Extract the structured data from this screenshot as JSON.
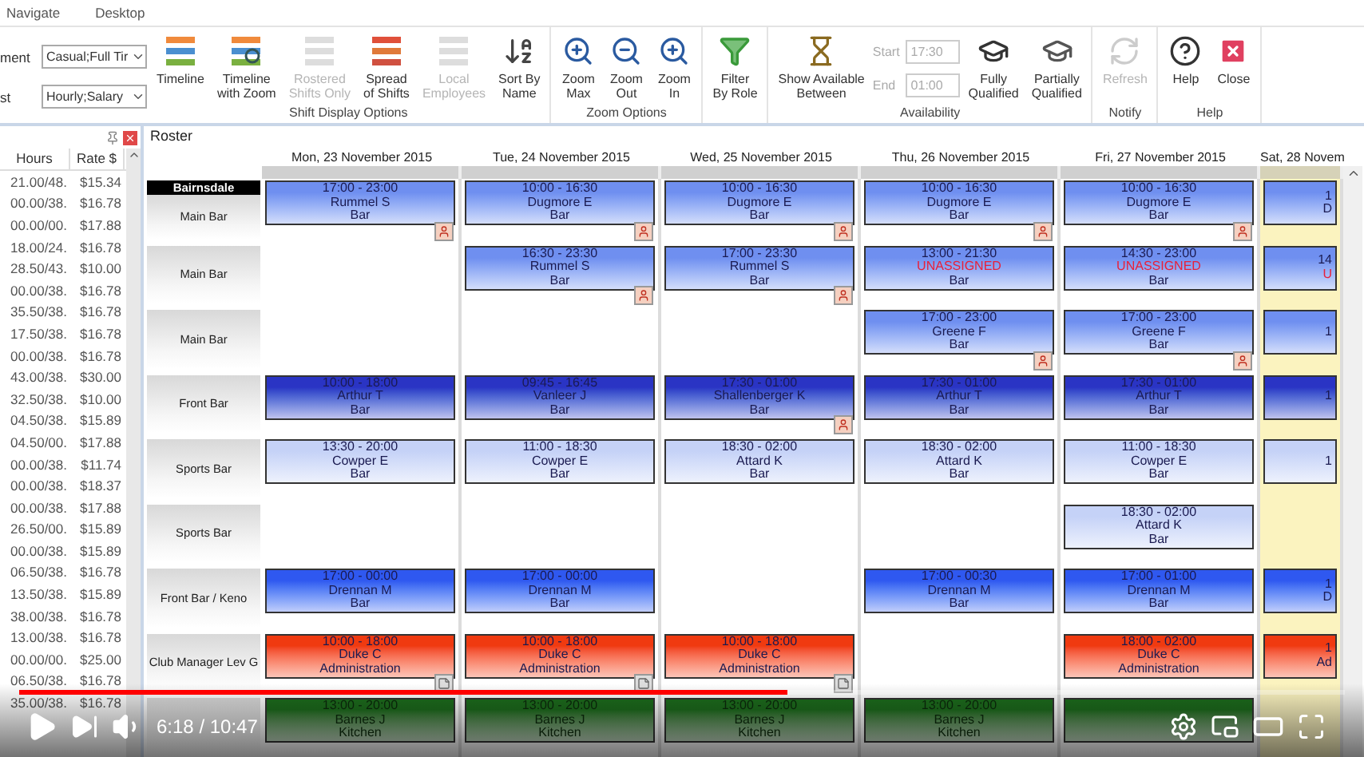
{
  "menu": [
    {
      "label": "Navigate"
    },
    {
      "label": "Desktop"
    }
  ],
  "filters": [
    {
      "label": "ment",
      "value": "Casual;Full Tir"
    },
    {
      "label": "st",
      "value": "Hourly;Salary"
    }
  ],
  "ribbon": [
    {
      "title": "Shift Display Options",
      "items": [
        {
          "kind": "timeline",
          "label": "Timeline",
          "disabled": false
        },
        {
          "kind": "zoomtimeline",
          "label": "Timeline\nwith Zoom",
          "disabled": false
        },
        {
          "kind": "rostered",
          "label": "Rostered\nShifts Only",
          "disabled": true
        },
        {
          "kind": "spread",
          "label": "Spread\nof Shifts",
          "disabled": false
        },
        {
          "kind": "local",
          "label": "Local\nEmployees",
          "disabled": true
        },
        {
          "kind": "sort",
          "label": "Sort By\nName",
          "disabled": false
        }
      ]
    },
    {
      "title": "Zoom Options",
      "items": [
        {
          "kind": "zoommax",
          "label": "Zoom\nMax",
          "disabled": false
        },
        {
          "kind": "zoomout",
          "label": "Zoom\nOut",
          "disabled": false
        },
        {
          "kind": "zoomin",
          "label": "Zoom\nIn",
          "disabled": false
        }
      ]
    },
    {
      "items": [
        {
          "kind": "filter",
          "label": "Filter\nBy Role",
          "disabled": false
        }
      ]
    },
    {
      "title": "Availability",
      "items": [
        {
          "kind": "available",
          "label": "Show Available\nBetween",
          "disabled": false
        },
        {
          "kind": "times",
          "fields": [
            {
              "label": "Start",
              "value": "17:30"
            },
            {
              "label": "End",
              "value": "01:00"
            }
          ]
        },
        {
          "kind": "fully",
          "label": "Fully\nQualified",
          "disabled": false
        },
        {
          "kind": "partially",
          "label": "Partially\nQualified",
          "disabled": false
        }
      ]
    },
    {
      "title": "Notify",
      "items": [
        {
          "kind": "refresh",
          "label": "Refresh",
          "disabled": true
        }
      ]
    },
    {
      "title": "Help",
      "items": [
        {
          "kind": "help",
          "label": "Help",
          "disabled": false
        },
        {
          "kind": "close",
          "label": "Close",
          "disabled": false
        }
      ]
    }
  ],
  "employees": {
    "columns": [
      "Hours",
      "Rate $"
    ],
    "rows": [
      [
        "21.00/48.",
        "$15.34"
      ],
      [
        "00.00/38.",
        "$16.78"
      ],
      [
        "00.00/00.",
        "$17.88"
      ],
      [
        "18.00/24.",
        "$16.78"
      ],
      [
        "28.50/43.",
        "$10.00"
      ],
      [
        "00.00/38.",
        "$16.78"
      ],
      [
        "35.50/38.",
        "$16.78"
      ],
      [
        "17.50/38.",
        "$16.78"
      ],
      [
        "00.00/38.",
        "$16.78"
      ],
      [
        "43.00/38.",
        "$30.00"
      ],
      [
        "32.50/38.",
        "$10.00"
      ],
      [
        "04.50/38.",
        "$15.89"
      ],
      [
        "04.50/00.",
        "$17.88"
      ],
      [
        "00.00/38.",
        "$11.74"
      ],
      [
        "00.00/38.",
        "$18.37"
      ],
      [
        "00.00/38.",
        "$17.88"
      ],
      [
        "26.50/00.",
        "$15.89"
      ],
      [
        "00.00/38.",
        "$15.89"
      ],
      [
        "06.50/38.",
        "$16.78"
      ],
      [
        "13.50/38.",
        "$15.89"
      ],
      [
        "38.00/38.",
        "$16.78"
      ],
      [
        "13.00/38.",
        "$16.78"
      ],
      [
        "00.00/00.",
        "$25.00"
      ],
      [
        "06.50/38.",
        "$16.78"
      ],
      [
        "35.00/38.",
        "$16.78"
      ]
    ]
  },
  "roster": {
    "title": "Roster",
    "location": "Bairnsdale",
    "days": [
      {
        "label": "Mon, 23 November 2015",
        "available": false
      },
      {
        "label": "Tue, 24 November 2015",
        "available": false
      },
      {
        "label": "Wed, 25 November 2015",
        "available": false
      },
      {
        "label": "Thu, 26 November 2015",
        "available": false
      },
      {
        "label": "Fri, 27 November 2015",
        "available": false
      },
      {
        "label": "Sat, 28 Novem",
        "available": true
      }
    ],
    "rows": [
      {
        "label": "Main Bar",
        "cells": [
          {
            "time": "17:00 - 23:00",
            "name": "Rummel S",
            "role": "Bar",
            "color": "#6f8ff0",
            "unassigned": false,
            "flag": true,
            "note": false
          },
          {
            "time": "10:00 - 16:30",
            "name": "Dugmore E",
            "role": "Bar",
            "color": "#6f8ff0",
            "unassigned": false,
            "flag": true,
            "note": false
          },
          {
            "time": "10:00 - 16:30",
            "name": "Dugmore E",
            "role": "Bar",
            "color": "#6f8ff0",
            "unassigned": false,
            "flag": true,
            "note": false
          },
          {
            "time": "10:00 - 16:30",
            "name": "Dugmore E",
            "role": "Bar",
            "color": "#6f8ff0",
            "unassigned": false,
            "flag": true,
            "note": false
          },
          {
            "time": "10:00 - 16:30",
            "name": "Dugmore E",
            "role": "Bar",
            "color": "#6f8ff0",
            "unassigned": false,
            "flag": true,
            "note": false
          },
          {
            "time": "1",
            "name": "D",
            "color": "#6f8ff0",
            "unassigned": false,
            "flag": false,
            "note": false
          }
        ]
      },
      {
        "label": "Main Bar",
        "cells": [
          null,
          {
            "time": "16:30 - 23:30",
            "name": "Rummel S",
            "role": "Bar",
            "color": "#6f8ff0",
            "unassigned": false,
            "flag": true,
            "note": false
          },
          {
            "time": "17:00 - 23:30",
            "name": "Rummel S",
            "role": "Bar",
            "color": "#6f8ff0",
            "unassigned": false,
            "flag": true,
            "note": false
          },
          {
            "time": "13:00 - 21:30",
            "name": "UNASSIGNED",
            "role": "Bar",
            "color": "#6f8ff0",
            "unassigned": true,
            "flag": false,
            "note": false
          },
          {
            "time": "14:30 - 23:00",
            "name": "UNASSIGNED",
            "role": "Bar",
            "color": "#6f8ff0",
            "unassigned": true,
            "flag": false,
            "note": false
          },
          {
            "time": "14",
            "name": "U",
            "color": "#6f8ff0",
            "unassigned": true,
            "flag": false,
            "note": false
          }
        ]
      },
      {
        "label": "Main Bar",
        "cells": [
          null,
          null,
          null,
          {
            "time": "17:00 - 23:00",
            "name": "Greene F",
            "role": "Bar",
            "color": "#6f8ff0",
            "unassigned": false,
            "flag": true,
            "note": false
          },
          {
            "time": "17:00 - 23:00",
            "name": "Greene F",
            "role": "Bar",
            "color": "#6f8ff0",
            "unassigned": false,
            "flag": true,
            "note": false
          },
          {
            "time": "1",
            "color": "#6f8ff0",
            "flag": false,
            "note": false
          }
        ]
      },
      {
        "label": "Front Bar",
        "cells": [
          {
            "time": "10:00 - 18:00",
            "name": "Arthur T",
            "role": "Bar",
            "color": "#2a34c4",
            "unassigned": false,
            "flag": false,
            "note": false
          },
          {
            "time": "09:45 - 16:45",
            "name": "Vanleer J",
            "role": "Bar",
            "color": "#2a34c4",
            "unassigned": false,
            "flag": false,
            "note": false
          },
          {
            "time": "17:30 - 01:00",
            "name": "Shallenberger K",
            "role": "Bar",
            "color": "#2a34c4",
            "unassigned": false,
            "flag": true,
            "note": false
          },
          {
            "time": "17:30 - 01:00",
            "name": "Arthur T",
            "role": "Bar",
            "color": "#2a34c4",
            "unassigned": false,
            "flag": false,
            "note": false
          },
          {
            "time": "17:30 - 01:00",
            "name": "Arthur T",
            "role": "Bar",
            "color": "#2a34c4",
            "unassigned": false,
            "flag": false,
            "note": false
          },
          {
            "time": "1",
            "color": "#2a34c4",
            "flag": false,
            "note": false
          }
        ]
      },
      {
        "label": "Sports Bar",
        "cells": [
          {
            "time": "13:30 - 20:00",
            "name": "Cowper E",
            "role": "Bar",
            "color": "#c5d2f7",
            "unassigned": false,
            "flag": false,
            "note": false
          },
          {
            "time": "11:00 - 18:30",
            "name": "Cowper E",
            "role": "Bar",
            "color": "#c5d2f7",
            "unassigned": false,
            "flag": false,
            "note": false
          },
          {
            "time": "18:30 - 02:00",
            "name": "Attard K",
            "role": "Bar",
            "color": "#c5d2f7",
            "unassigned": false,
            "flag": false,
            "note": false
          },
          {
            "time": "18:30 - 02:00",
            "name": "Attard K",
            "role": "Bar",
            "color": "#c5d2f7",
            "unassigned": false,
            "flag": false,
            "note": false
          },
          {
            "time": "11:00 - 18:30",
            "name": "Cowper E",
            "role": "Bar",
            "color": "#c5d2f7",
            "unassigned": false,
            "flag": false,
            "note": false
          },
          {
            "time": "1",
            "color": "#c5d2f7",
            "flag": false,
            "note": false
          }
        ]
      },
      {
        "label": "Sports Bar",
        "cells": [
          null,
          null,
          null,
          null,
          {
            "time": "18:30 - 02:00",
            "name": "Attard K",
            "role": "Bar",
            "color": "#c5d2f7",
            "unassigned": false,
            "flag": false,
            "note": false
          },
          null
        ]
      },
      {
        "label": "Front Bar / Keno",
        "cells": [
          {
            "time": "17:00 - 00:00",
            "name": "Drennan M",
            "role": "Bar",
            "color": "#2f58f0",
            "unassigned": false,
            "flag": false,
            "note": false
          },
          {
            "time": "17:00 - 00:00",
            "name": "Drennan M",
            "role": "Bar",
            "color": "#2f58f0",
            "unassigned": false,
            "flag": false,
            "note": false
          },
          null,
          {
            "time": "17:00 - 00:30",
            "name": "Drennan M",
            "role": "Bar",
            "color": "#2f58f0",
            "unassigned": false,
            "flag": false,
            "note": false
          },
          {
            "time": "17:00 - 01:00",
            "name": "Drennan M",
            "role": "Bar",
            "color": "#2f58f0",
            "unassigned": false,
            "flag": false,
            "note": false
          },
          {
            "time": "1",
            "name": "D",
            "color": "#2f58f0",
            "unassigned": false,
            "flag": false,
            "note": false
          }
        ]
      },
      {
        "label": "Club Manager Lev G",
        "cells": [
          {
            "time": "10:00 - 18:00",
            "name": "Duke C",
            "role": "Administration",
            "color": "#f03a10",
            "unassigned": false,
            "flag": false,
            "note": true
          },
          {
            "time": "10:00 - 18:00",
            "name": "Duke C",
            "role": "Administration",
            "color": "#f03a10",
            "unassigned": false,
            "flag": false,
            "note": true
          },
          {
            "time": "10:00 - 18:00",
            "name": "Duke C",
            "role": "Administration",
            "color": "#f03a10",
            "unassigned": false,
            "flag": false,
            "note": true
          },
          null,
          {
            "time": "18:00 - 02:00",
            "name": "Duke C",
            "role": "Administration",
            "color": "#f03a10",
            "unassigned": false,
            "flag": false,
            "note": false
          },
          {
            "time": "1",
            "role": "Ad",
            "color": "#f03a10",
            "flag": false,
            "note": false
          }
        ]
      },
      {
        "cells": [
          {
            "time": "13:00 - 20:00",
            "name": "Barnes J",
            "role": "Kitchen",
            "color": "#1d6d1d",
            "unassigned": false,
            "flag": false,
            "note": false
          },
          {
            "time": "13:00 - 20:00",
            "name": "Barnes J",
            "role": "Kitchen",
            "color": "#1d6d1d",
            "unassigned": false,
            "flag": false,
            "note": false
          },
          {
            "time": "13:00 - 20:00",
            "name": "Barnes J",
            "role": "Kitchen",
            "color": "#1d6d1d",
            "unassigned": false,
            "flag": false,
            "note": false
          },
          {
            "time": "13:00 - 20:00",
            "name": "Barnes J",
            "role": "Kitchen",
            "color": "#1d6d1d",
            "unassigned": false,
            "flag": false,
            "note": false
          },
          {
            "color": "#1d6d1d",
            "flag": false,
            "note": false
          },
          null
        ]
      }
    ]
  },
  "video": {
    "time": "6:18 / 10:47",
    "progress": {
      "level": 0.58
    }
  }
}
